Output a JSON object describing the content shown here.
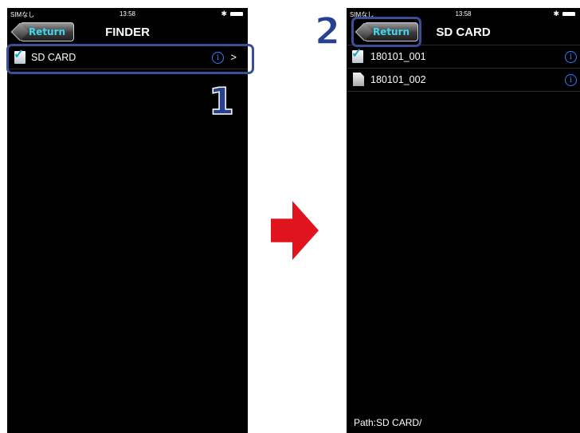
{
  "left_screen": {
    "status": {
      "carrier": "SIMなし",
      "time": "13:58",
      "bluetooth": "bluetooth-icon",
      "battery": "battery-icon"
    },
    "nav": {
      "return_label": "Return",
      "title": "FINDER"
    },
    "rows": [
      {
        "label": "SD CARD",
        "icon": "sd-card-check-icon",
        "info": "i",
        "chevron": ">"
      }
    ],
    "step_label": "1"
  },
  "right_screen": {
    "status": {
      "carrier": "SIMなし",
      "time": "13:58",
      "bluetooth": "bluetooth-icon",
      "battery": "battery-icon"
    },
    "nav": {
      "return_label": "Return",
      "title": "SD CARD"
    },
    "rows": [
      {
        "label": "180101_001",
        "icon": "folder-check-icon",
        "info": "i"
      },
      {
        "label": "180101_002",
        "icon": "file-icon",
        "info": "i"
      }
    ],
    "path": "Path:SD CARD/",
    "step_label": "2"
  },
  "colors": {
    "highlight": "#3b4f96",
    "step_number": "#27408f",
    "arrow": "#e0141e",
    "info": "#2f7dff",
    "return_text": "#3fd6ee"
  }
}
